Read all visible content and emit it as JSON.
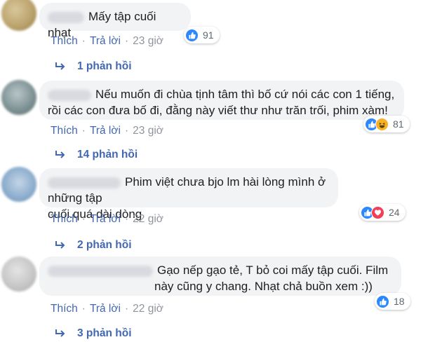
{
  "comments": [
    {
      "text": "Mấy tập cuối nhạt",
      "actions": {
        "like": "Thích",
        "reply": "Trả lời",
        "time": "23 giờ"
      },
      "reactions": {
        "types": [
          "like"
        ],
        "count": "91"
      },
      "replies": "1 phản hồi"
    },
    {
      "text_line1": "Nếu muốn đi chùa tịnh tâm thì bố cứ nói các con 1 tiếng,",
      "text_line2": "rồi các con đưa bố đi, đằng này viết thư như trăn trối, phim xàm!",
      "actions": {
        "like": "Thích",
        "reply": "Trả lời",
        "time": "23 giờ"
      },
      "reactions": {
        "types": [
          "like",
          "haha"
        ],
        "count": "81"
      },
      "replies": "14 phản hồi"
    },
    {
      "text_line1": "Phim việt chưa bjo lm hài lòng mình ở những tập",
      "text_line2": "cuối.quá dài dòng",
      "actions": {
        "like": "Thích",
        "reply": "Trả lời",
        "time": "22 giờ"
      },
      "reactions": {
        "types": [
          "like",
          "love"
        ],
        "count": "24"
      },
      "replies": "2 phản hồi"
    },
    {
      "text_line1": "Gạo nếp gạo tẻ, T bỏ coi mấy tập cuối. Film",
      "text_line2": "này cũng y chang. Nhạt chả buồn xem :))",
      "actions": {
        "like": "Thích",
        "reply": "Trả lời",
        "time": "22 giờ"
      },
      "reactions": {
        "types": [
          "like"
        ],
        "count": "18"
      },
      "replies": "3 phản hồi"
    }
  ],
  "colors": {
    "link": "#4267b2",
    "meta": "#90949c",
    "bubble": "#f2f3f5",
    "like": "#2d88ff",
    "love": "#f33e58",
    "haha": "#f7b125"
  }
}
